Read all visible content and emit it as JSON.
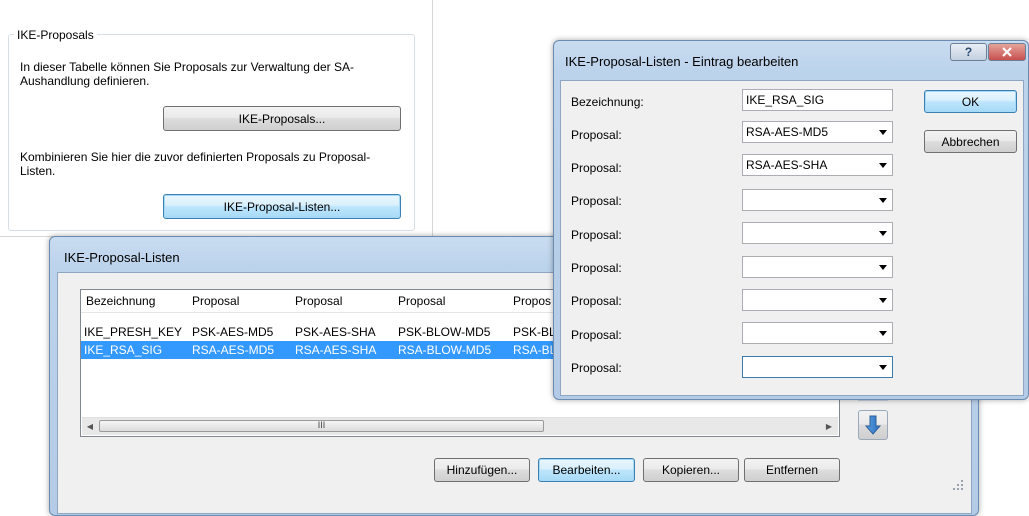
{
  "settings_panel": {
    "group_title": "IKE-Proposals",
    "text1": "In dieser Tabelle können Sie Proposals zur Verwaltung der SA-Aushandlung definieren.",
    "button1": "IKE-Proposals...",
    "text2": "Kombinieren Sie hier die zuvor definierten Proposals zu Proposal-Listen.",
    "button2": "IKE-Proposal-Listen..."
  },
  "list_dialog": {
    "title": "IKE-Proposal-Listen",
    "columns": [
      "Bezeichnung",
      "Proposal",
      "Proposal",
      "Proposal",
      "Propos"
    ],
    "rows": [
      {
        "cells": [
          "IKE_PRESH_KEY",
          "PSK-AES-MD5",
          "PSK-AES-SHA",
          "PSK-BLOW-MD5",
          "PSK-BL"
        ],
        "selected": false
      },
      {
        "cells": [
          "IKE_RSA_SIG",
          "RSA-AES-MD5",
          "RSA-AES-SHA",
          "RSA-BLOW-MD5",
          "RSA-BL"
        ],
        "selected": true
      }
    ],
    "scroll_thumb_label": "III",
    "buttons": {
      "add": "Hinzufügen...",
      "edit": "Bearbeiten...",
      "copy": "Kopieren...",
      "remove": "Entfernen"
    }
  },
  "edit_dialog": {
    "title": "IKE-Proposal-Listen - Eintrag bearbeiten",
    "help_glyph": "?",
    "name_label": "Bezeichnung:",
    "name_value": "IKE_RSA_SIG",
    "proposal_label": "Proposal:",
    "proposals": [
      "RSA-AES-MD5",
      "RSA-AES-SHA",
      "",
      "",
      "",
      "",
      "",
      ""
    ],
    "ok": "OK",
    "cancel": "Abbrechen"
  },
  "colors": {
    "selection": "#3399ff",
    "close_button": "#c75050",
    "title_bar": "#bcd3ec"
  }
}
